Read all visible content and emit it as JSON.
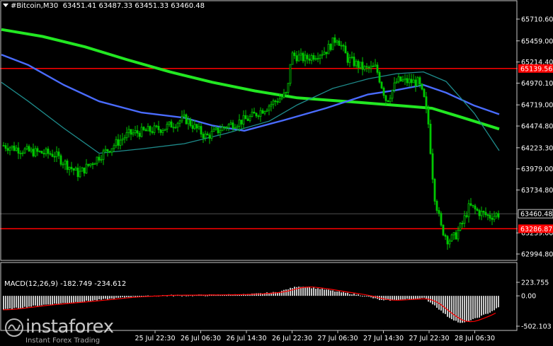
{
  "header": {
    "symbol": "#Bitcoin,M30",
    "ohlc": "63451.41 63487.33 63451.33 63460.48"
  },
  "price_axis": {
    "ticks": [
      "65710.60",
      "65459.00",
      "65214.40",
      "64970.10",
      "64719.00",
      "64474.80",
      "64223.30",
      "63979.00",
      "63734.80",
      "63239.00",
      "62994.80"
    ],
    "tick_values": [
      65710.6,
      65459.0,
      65214.4,
      64970.1,
      64719.0,
      64474.8,
      64223.3,
      63979.0,
      63734.8,
      63239.0,
      62994.8
    ],
    "current_price": "63460.48",
    "current_value": 63460.48,
    "resistance_label": "65139.56",
    "resistance_value": 65139.56,
    "support_label": "63286.87",
    "support_value": 63286.87
  },
  "time_axis": {
    "labels": [
      "25 Jul 22:30",
      "26 Jul 06:30",
      "26 Jul 14:30",
      "26 Jul 22:30",
      "27 Jul 06:30",
      "27 Jul 14:30",
      "27 Jul 22:30",
      "28 Jul 06:30"
    ]
  },
  "macd": {
    "label": "MACD(12,26,9) -182.749 -234.612",
    "ticks": [
      "223.755",
      "0.00",
      "-502.103"
    ],
    "tick_values": [
      223.755,
      0,
      -502.103
    ]
  },
  "branding": {
    "name": "instaforex",
    "tagline": "Instant Forex Trading"
  },
  "colors": {
    "background": "#000000",
    "candle_up": "#00c800",
    "candle_down": "#00c800",
    "ma_fast": "#1e8b8b",
    "ma_mid": "#4a6cff",
    "ma_slow": "#22e822",
    "level_line": "#ff0000",
    "macd_hist": "#c8c8c8",
    "macd_signal": "#ff0000"
  }
}
